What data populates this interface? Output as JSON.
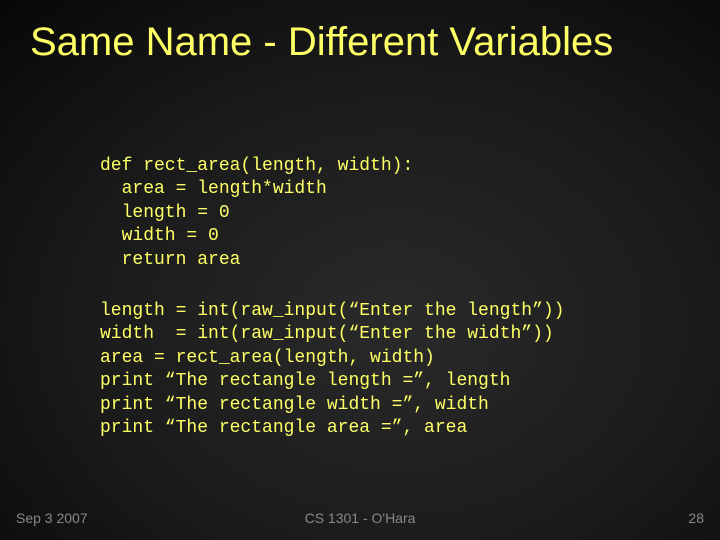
{
  "title": "Same Name - Different Variables",
  "code": {
    "line1": "def rect_area(length, width):",
    "line2": "  area = length*width",
    "line3": "  length = 0",
    "line4": "  width = 0",
    "line5": "  return area",
    "line6": "length = int(raw_input(“Enter the length”))",
    "line7": "width  = int(raw_input(“Enter the width”))",
    "line8": "area = rect_area(length, width)",
    "line9": "print “The rectangle length =”, length",
    "line10": "print “The rectangle width =”, width",
    "line11": "print “The rectangle area =”, area"
  },
  "footer": {
    "date": "Sep 3 2007",
    "course": "CS 1301 - O'Hara",
    "page": "28"
  }
}
